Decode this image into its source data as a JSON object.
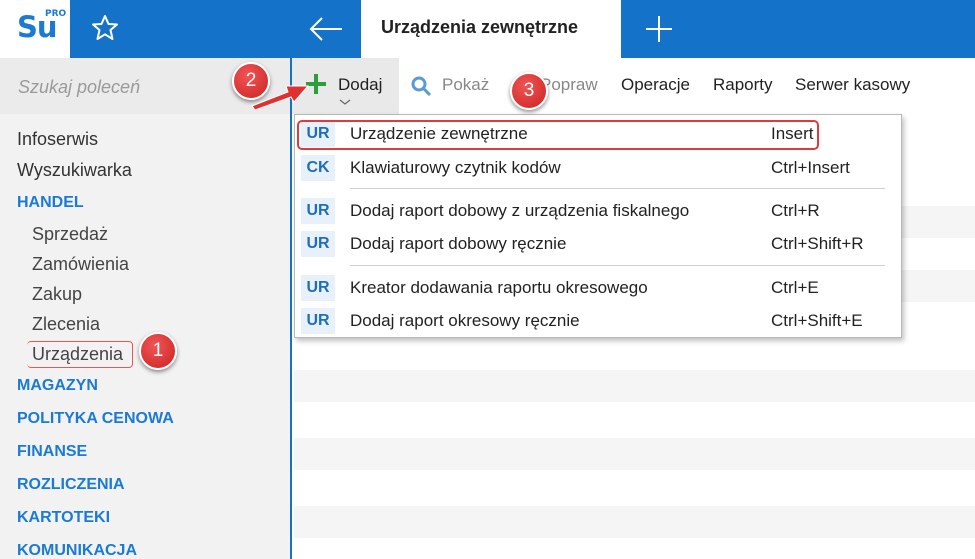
{
  "app": {
    "logo_text": "Su",
    "logo_badge": "PRO"
  },
  "header": {
    "active_tab": "Urządzenia zewnętrzne"
  },
  "search": {
    "placeholder": "Szukaj poleceń"
  },
  "nav": {
    "infoserwis": "Infoserwis",
    "wyszukiwarka": "Wyszukiwarka",
    "handel": "HANDEL",
    "sprzedaz": "Sprzedaż",
    "zamowienia": "Zamówienia",
    "zakup": "Zakup",
    "zlecenia": "Zlecenia",
    "urzadzenia": "Urządzenia",
    "magazyn": "MAGAZYN",
    "polityka": "POLITYKA CENOWA",
    "finanse": "FINANSE",
    "rozliczenia": "ROZLICZENIA",
    "kartoteki": "KARTOTEKI",
    "komunikacja": "KOMUNIKACJA"
  },
  "toolbar": {
    "dodaj": "Dodaj",
    "pokaz": "Pokaż",
    "popraw": "Popraw",
    "operacje": "Operacje",
    "raporty": "Raporty",
    "serwer": "Serwer kasowy"
  },
  "menu": {
    "items": [
      {
        "badge": "UR",
        "label": "Urządzenie zewnętrzne",
        "shortcut": "Insert"
      },
      {
        "badge": "CK",
        "label": "Klawiaturowy czytnik kodów",
        "shortcut": "Ctrl+Insert"
      },
      {
        "badge": "UR",
        "label": "Dodaj raport dobowy z urządzenia fiskalnego",
        "shortcut": "Ctrl+R"
      },
      {
        "badge": "UR",
        "label": "Dodaj raport dobowy ręcznie",
        "shortcut": "Ctrl+Shift+R"
      },
      {
        "badge": "UR",
        "label": "Kreator dodawania raportu okresowego",
        "shortcut": "Ctrl+E"
      },
      {
        "badge": "UR",
        "label": "Dodaj raport okresowy ręcznie",
        "shortcut": "Ctrl+Shift+E"
      }
    ]
  },
  "callouts": {
    "one": "1",
    "two": "2",
    "three": "3"
  },
  "colors": {
    "brand": "#1473c9",
    "callout": "#dd3333",
    "section": "#1a7ad4"
  }
}
